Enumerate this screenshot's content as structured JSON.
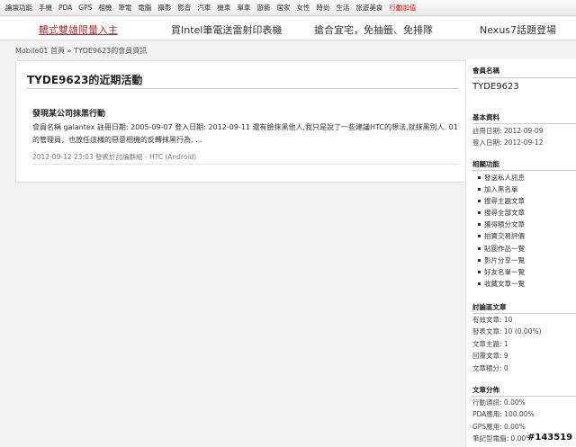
{
  "topnav": {
    "items": [
      "論壇功能",
      "手機",
      "PDA",
      "GPS",
      "相機",
      "筆電",
      "電腦",
      "攝影",
      "影音",
      "汽車",
      "機車",
      "單車",
      "遊藝",
      "居家",
      "女性",
      "時尚",
      "生活",
      "旅遊美食"
    ],
    "hot": "行動加值"
  },
  "promo": {
    "items": [
      "轎式雙雄限量入主",
      "買Intel筆電送雷射印表機",
      "搶合宜宅，免抽籤、免排隊",
      "Nexus7話題登場"
    ]
  },
  "breadcrumb": "Mobile01 首頁 » TYDE9623的會員資訊",
  "main": {
    "heading": "TYDE9623的近期活動",
    "post": {
      "title": "發現某公司抹黑行動",
      "body": "會員名稱 galantex 註冊日期: 2005-09-07 登入日期: 2012-09-11 還有臉抹黑他人,我只是說了一些建議HTC的想法,就抹黑別人. 01的管理員，也放任這樣的惡意相機的反轉抹黑行為, ...",
      "meta": "2012-09-12 23:03 發表於討論群組 - HTC (Android)"
    }
  },
  "sidebar": {
    "member_heading": "會員名稱",
    "member_name": "TYDE9623",
    "basic_heading": "基本資料",
    "register": "註冊日期: 2012-09-09",
    "login": "登入日期: 2012-09-12",
    "functions_heading": "相關功能",
    "functions": [
      "發送私人訊息",
      "加入黑名單",
      "搜尋主題文章",
      "搜尋全部文章",
      "獲得積分文章",
      "拍賣交易評價",
      "貼圖作品一覽",
      "影片分享一覽",
      "好友名單一覽",
      "收藏文章一覽"
    ],
    "forum_heading": "討論區文章",
    "forum_stats": [
      "有效文章: 10",
      "發表文章: 10 (0.00%)",
      "文章主題: 1",
      "回覆文章: 9",
      "文章積分: 0"
    ],
    "dist_heading": "文章分佈",
    "dist": [
      "行動通訊: 0.00%",
      "PDA應用: 100.00%",
      "GPS應用: 0.00%",
      "筆記型電腦: 0.00%"
    ]
  },
  "watermark": "#143519"
}
